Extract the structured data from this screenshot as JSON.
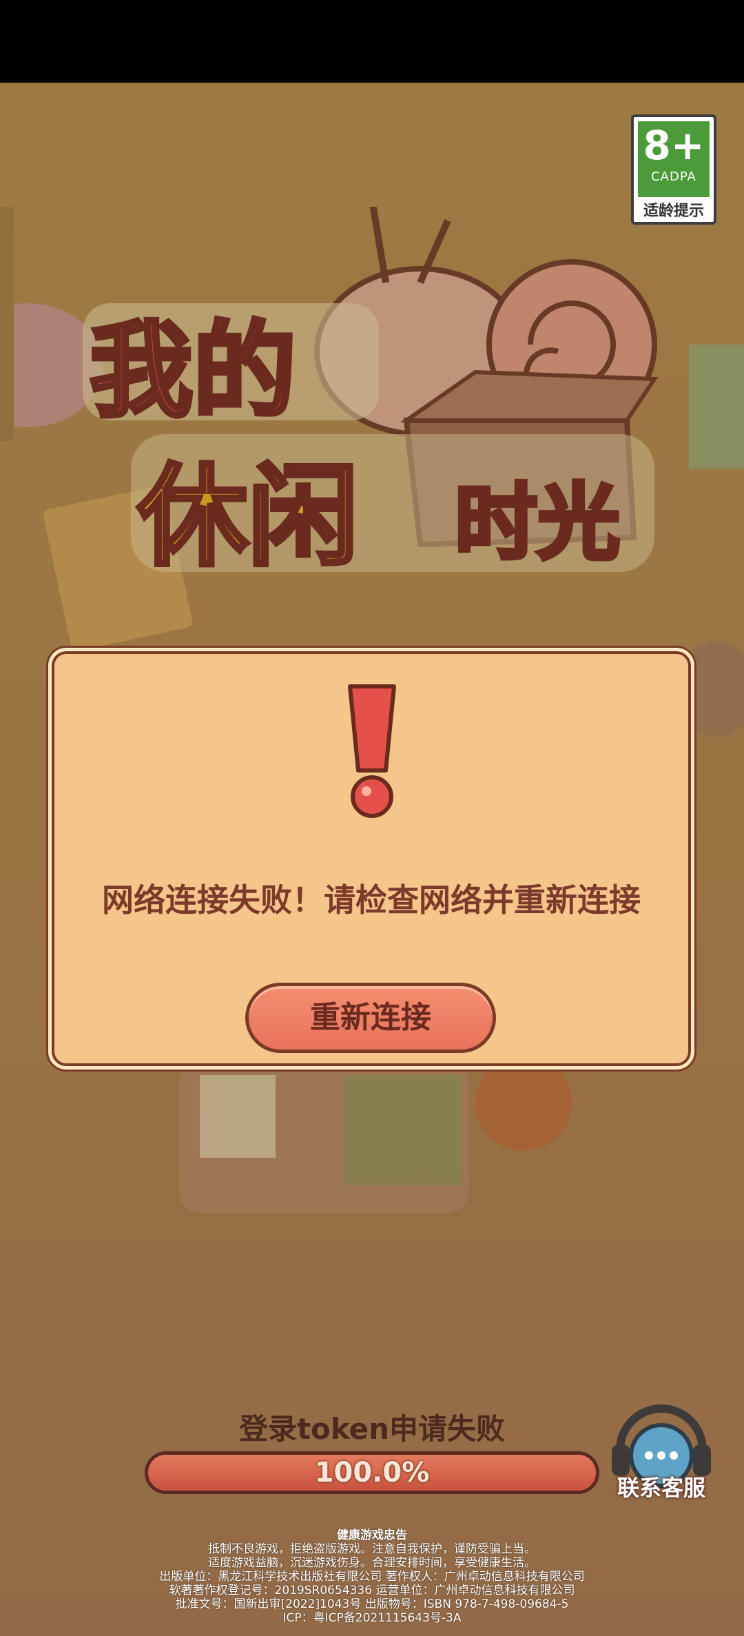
{
  "age_rating": {
    "number": "8+",
    "org": "CADPA",
    "tip": "适龄提示"
  },
  "dialog": {
    "message": "网络连接失败！请检查网络并重新连接",
    "retry_label": "重新连接"
  },
  "loading": {
    "status": "登录token申请失败",
    "progress_text": "100.0%",
    "progress_value": 1.0
  },
  "support": {
    "label": "联系客服"
  },
  "footer": {
    "lines": [
      "健康游戏忠告",
      "抵制不良游戏，拒绝盗版游戏。注意自我保护，谨防受骗上当。",
      "适度游戏益脑，沉迷游戏伤身。合理安排时间，享受健康生活。",
      "出版单位：黑龙江科学技术出版社有限公司   著作权人：广州卓动信息科技有限公司",
      "软著著作权登记号：2019SR0654336   运营单位：广州卓动信息科技有限公司",
      "批准文号：国新出审[2022]1043号   出版物号：ISBN 978-7-498-09684-5",
      "ICP：粤ICP备2021115643号-3A"
    ]
  },
  "colors": {
    "accent": "#e8735b",
    "dialog_bg": "#f5c68c",
    "text_dark": "#7b3a2a"
  },
  "icons": [
    "exclamation-icon",
    "customer-service-headset-icon"
  ]
}
